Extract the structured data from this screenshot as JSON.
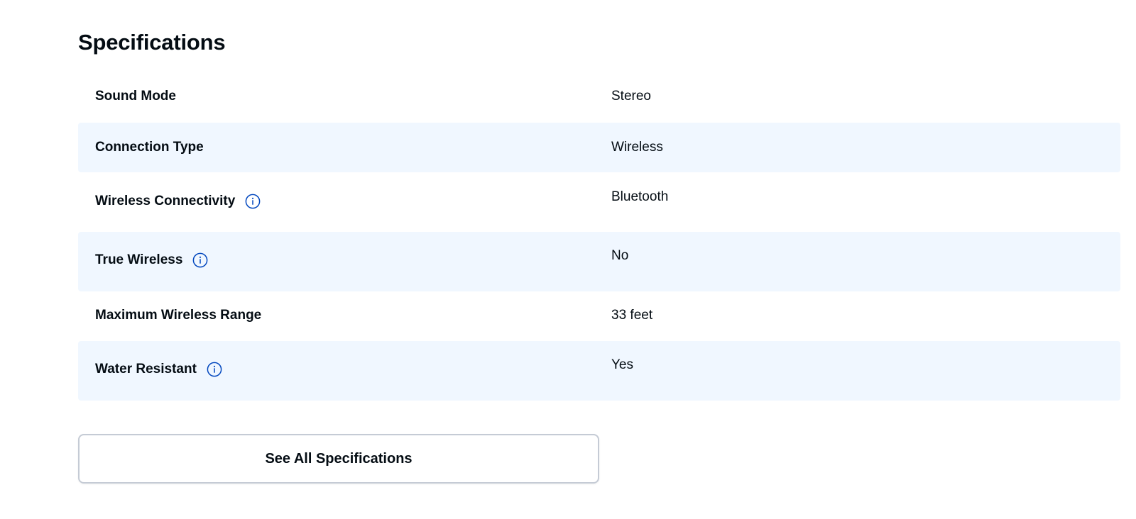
{
  "section": {
    "title": "Specifications"
  },
  "specs": [
    {
      "label": "Sound Mode",
      "value": "Stereo",
      "info": false
    },
    {
      "label": "Connection Type",
      "value": "Wireless",
      "info": false
    },
    {
      "label": "Wireless Connectivity",
      "value": "Bluetooth",
      "info": true
    },
    {
      "label": "True Wireless",
      "value": "No",
      "info": true
    },
    {
      "label": "Maximum Wireless Range",
      "value": "33 feet",
      "info": false
    },
    {
      "label": "Water Resistant",
      "value": "Yes",
      "info": true
    }
  ],
  "actions": {
    "see_all_label": "See All Specifications"
  },
  "colors": {
    "row_shade": "#f0f7ff",
    "info_icon": "#0046be",
    "text": "#040c13",
    "button_border": "#c5cbd5"
  },
  "icons": {
    "info": "info-circle-icon"
  }
}
